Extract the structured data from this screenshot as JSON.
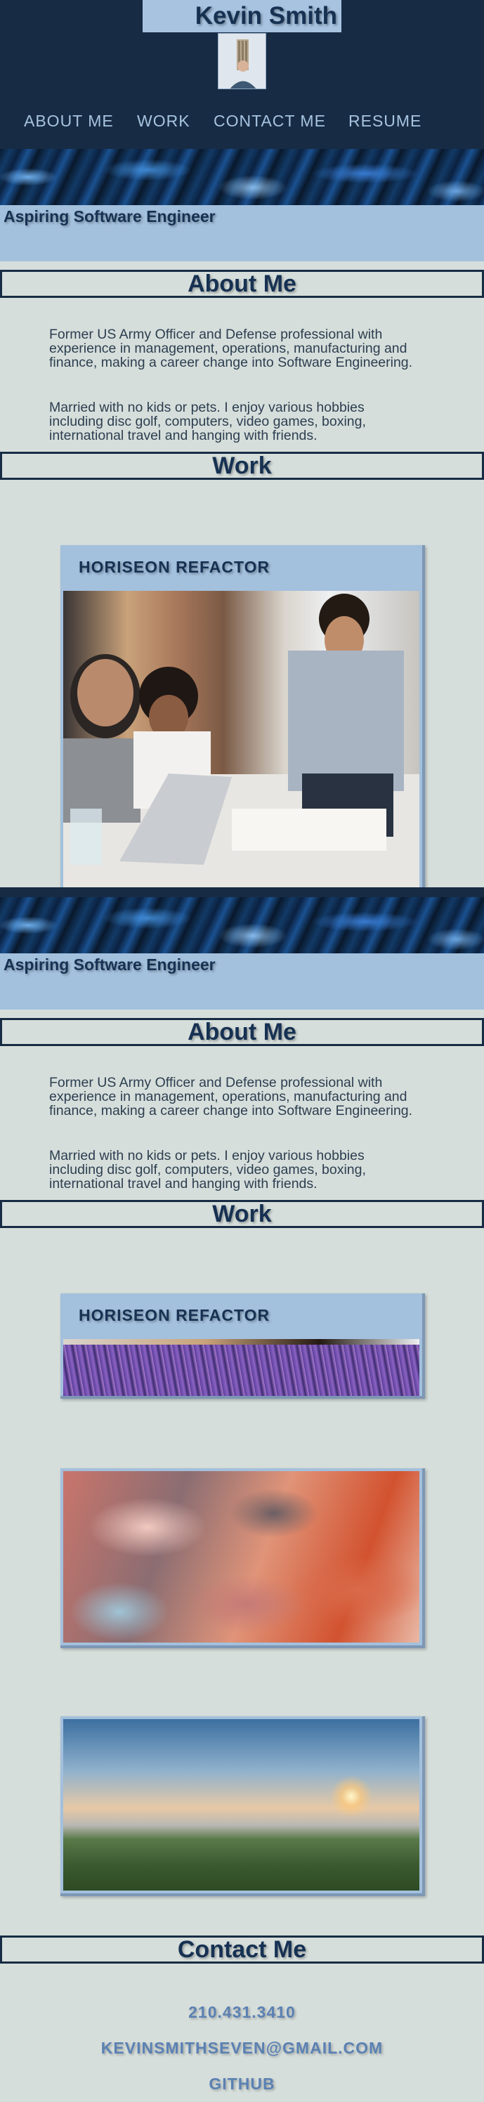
{
  "header": {
    "name": "Kevin Smith",
    "nav": [
      "ABOUT ME",
      "WORK",
      "CONTACT ME",
      "RESUME"
    ]
  },
  "hero": {
    "tagline": "Aspiring Software Engineer"
  },
  "about": {
    "heading": "About Me",
    "paragraph1": "Former US Army Officer and Defense professional with experience in management, operations, manufacturing and finance, making a career change into Software Engineering.",
    "paragraph2": "Married with no kids or pets. I enjoy various hobbies including disc golf, computers, video games, boxing, international travel and hanging with friends."
  },
  "work": {
    "heading": "Work",
    "project1_title": "HORISEON REFACTOR"
  },
  "contact": {
    "heading": "Contact Me",
    "phone": "210.431.3410",
    "email": "KEVINSMITHSEVEN@GMAIL.COM",
    "github": "GITHUB"
  },
  "colors": {
    "navy": "#172c44",
    "light_blue": "#a3c0dd",
    "background": "#d6dedb",
    "heading_text": "#163152",
    "link_blue": "#5b81b3"
  }
}
